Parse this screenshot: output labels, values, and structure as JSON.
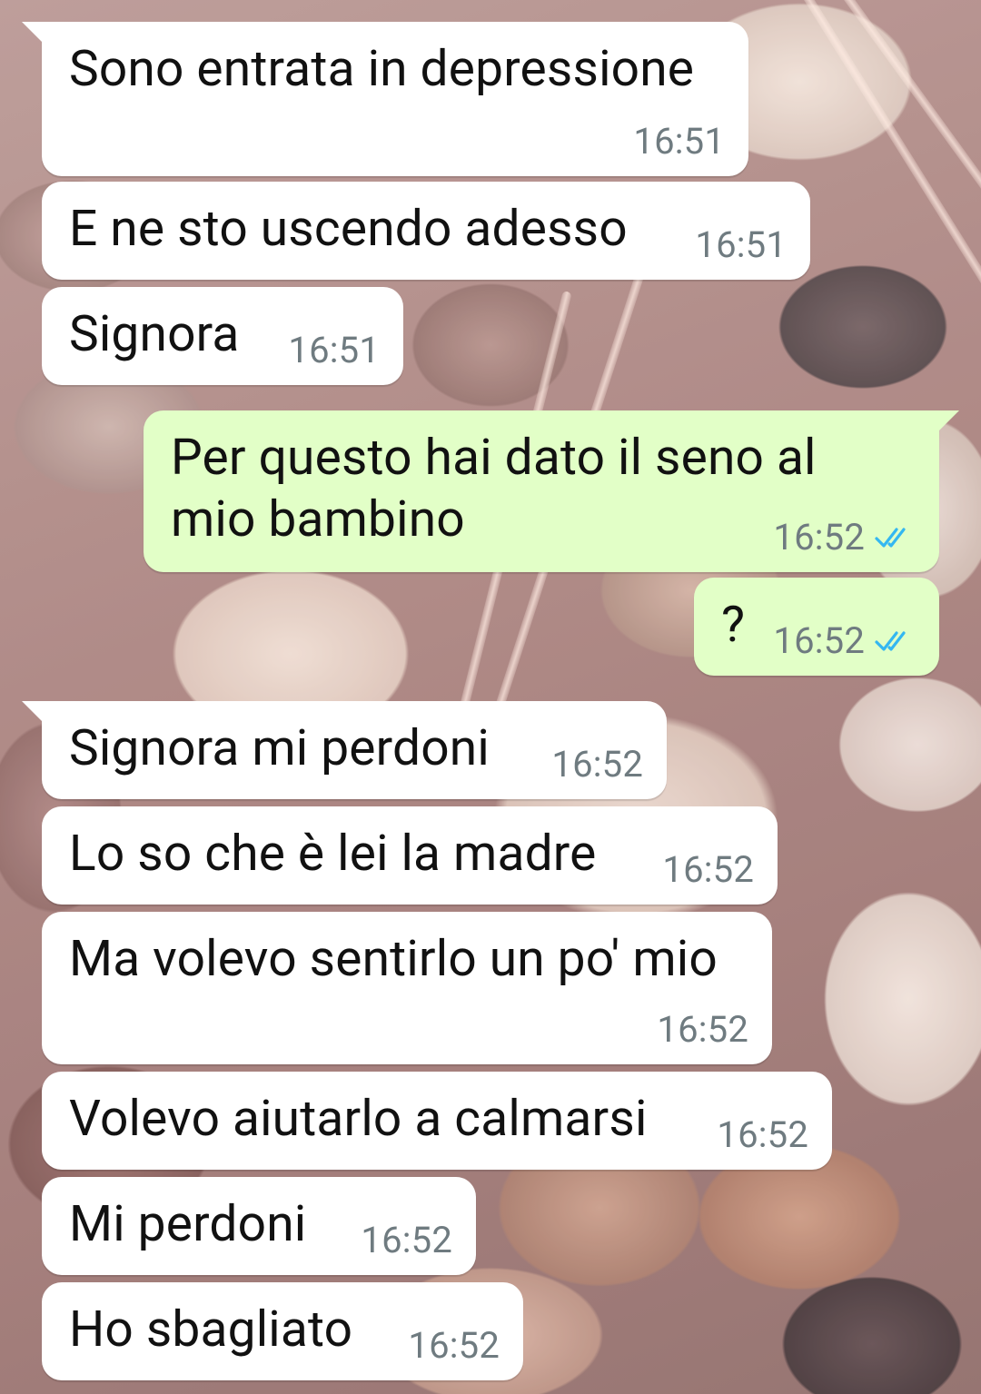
{
  "conversation": {
    "messages": [
      {
        "direction": "incoming",
        "text": "Sono entrata in depressione",
        "time": "16:51"
      },
      {
        "direction": "incoming",
        "text": "E ne sto uscendo adesso",
        "time": "16:51"
      },
      {
        "direction": "incoming",
        "text": "Signora",
        "time": "16:51"
      },
      {
        "direction": "outgoing",
        "text": "Per questo hai dato il seno al\nmio bambino",
        "time": "16:52",
        "status": "read"
      },
      {
        "direction": "outgoing",
        "text": "?",
        "time": "16:52",
        "status": "read"
      },
      {
        "direction": "incoming",
        "text": "Signora mi perdoni",
        "time": "16:52"
      },
      {
        "direction": "incoming",
        "text": "Lo so che è lei la madre",
        "time": "16:52"
      },
      {
        "direction": "incoming",
        "text": "Ma volevo sentirlo un po' mio",
        "time": "16:52"
      },
      {
        "direction": "incoming",
        "text": "Volevo aiutarlo a calmarsi",
        "time": "16:52"
      },
      {
        "direction": "incoming",
        "text": "Mi perdoni",
        "time": "16:52"
      },
      {
        "direction": "incoming",
        "text": "Ho sbagliato",
        "time": "16:52"
      }
    ]
  },
  "icons": {
    "read_receipt": "double-check-icon"
  },
  "colors": {
    "incoming_bubble": "#ffffff",
    "outgoing_bubble": "#e2ffc7",
    "timestamp": "#6f7b80",
    "read_ticks": "#34b7f1"
  }
}
